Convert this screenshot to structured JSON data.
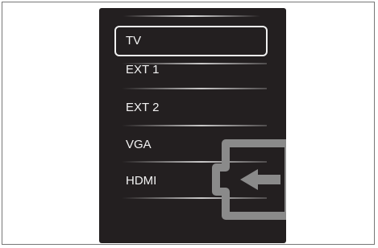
{
  "menu": {
    "items": [
      {
        "label": "TV",
        "selected": true
      },
      {
        "label": "EXT 1",
        "selected": false
      },
      {
        "label": "EXT 2",
        "selected": false
      },
      {
        "label": "VGA",
        "selected": false
      },
      {
        "label": "HDMI",
        "selected": false
      }
    ],
    "icon": "input-arrow-icon"
  },
  "colors": {
    "panel": "#231f20",
    "text": "#f2f2f2",
    "icon": "#8a8a8a"
  }
}
